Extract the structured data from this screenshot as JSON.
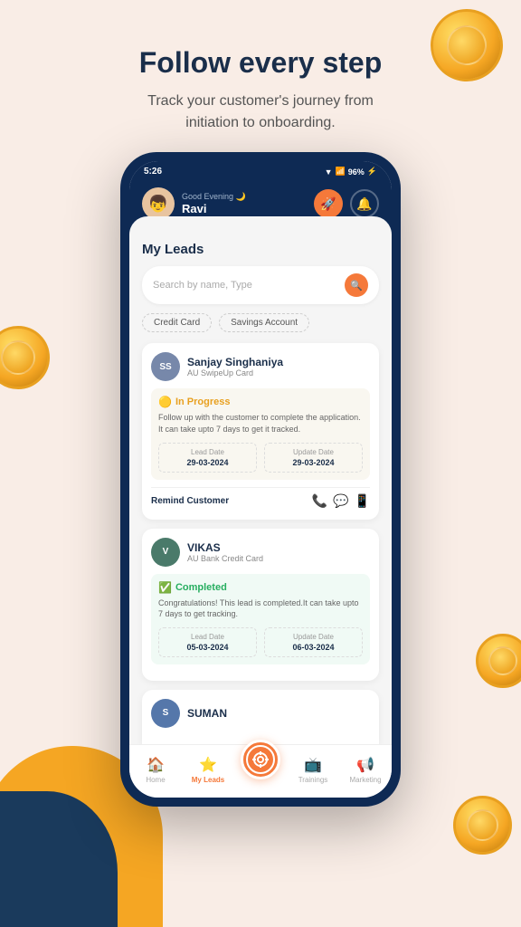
{
  "hero": {
    "title": "Follow every step",
    "subtitle": "Track your customer's journey from\ninitiation to onboarding."
  },
  "status_bar": {
    "time": "5:26",
    "battery": "96%"
  },
  "header": {
    "greeting": "Good Evening 🌙",
    "name": "Ravi"
  },
  "my_leads": {
    "title": "My Leads",
    "search_placeholder": "Search by name, Type"
  },
  "filters": {
    "items": [
      "Credit Card",
      "Savings Account"
    ]
  },
  "leads": [
    {
      "initials": "SS",
      "name": "Sanjay Singhaniya",
      "product": "AU SwipeUp Card",
      "status": "In Progress",
      "status_type": "progress",
      "description": "Follow up with the customer to complete the application. It can take upto 7 days to get it tracked.",
      "lead_date_label": "Lead Date",
      "lead_date": "29-03-2024",
      "update_date_label": "Update Date",
      "update_date": "29-03-2024",
      "remind_label": "Remind Customer"
    },
    {
      "initials": "V",
      "name": "VIKAS",
      "product": "AU Bank Credit Card",
      "status": "Completed",
      "status_type": "completed",
      "description": "Congratulations! This lead is completed.It can take upto 7 days to get tracking.",
      "lead_date_label": "Lead Date",
      "lead_date": "05-03-2024",
      "update_date_label": "Update Date",
      "update_date": "06-03-2024"
    },
    {
      "initials": "S",
      "name": "SUMAN",
      "product": "",
      "status": "",
      "status_type": "partial"
    }
  ],
  "bottom_nav": {
    "items": [
      {
        "label": "Home",
        "icon": "🏠",
        "active": false
      },
      {
        "label": "My Leads",
        "icon": "⭐",
        "active": true
      },
      {
        "label": "",
        "icon": "+",
        "active": false,
        "center": true
      },
      {
        "label": "Trainings",
        "icon": "📺",
        "active": false
      },
      {
        "label": "Marketing",
        "icon": "📢",
        "active": false
      }
    ]
  }
}
